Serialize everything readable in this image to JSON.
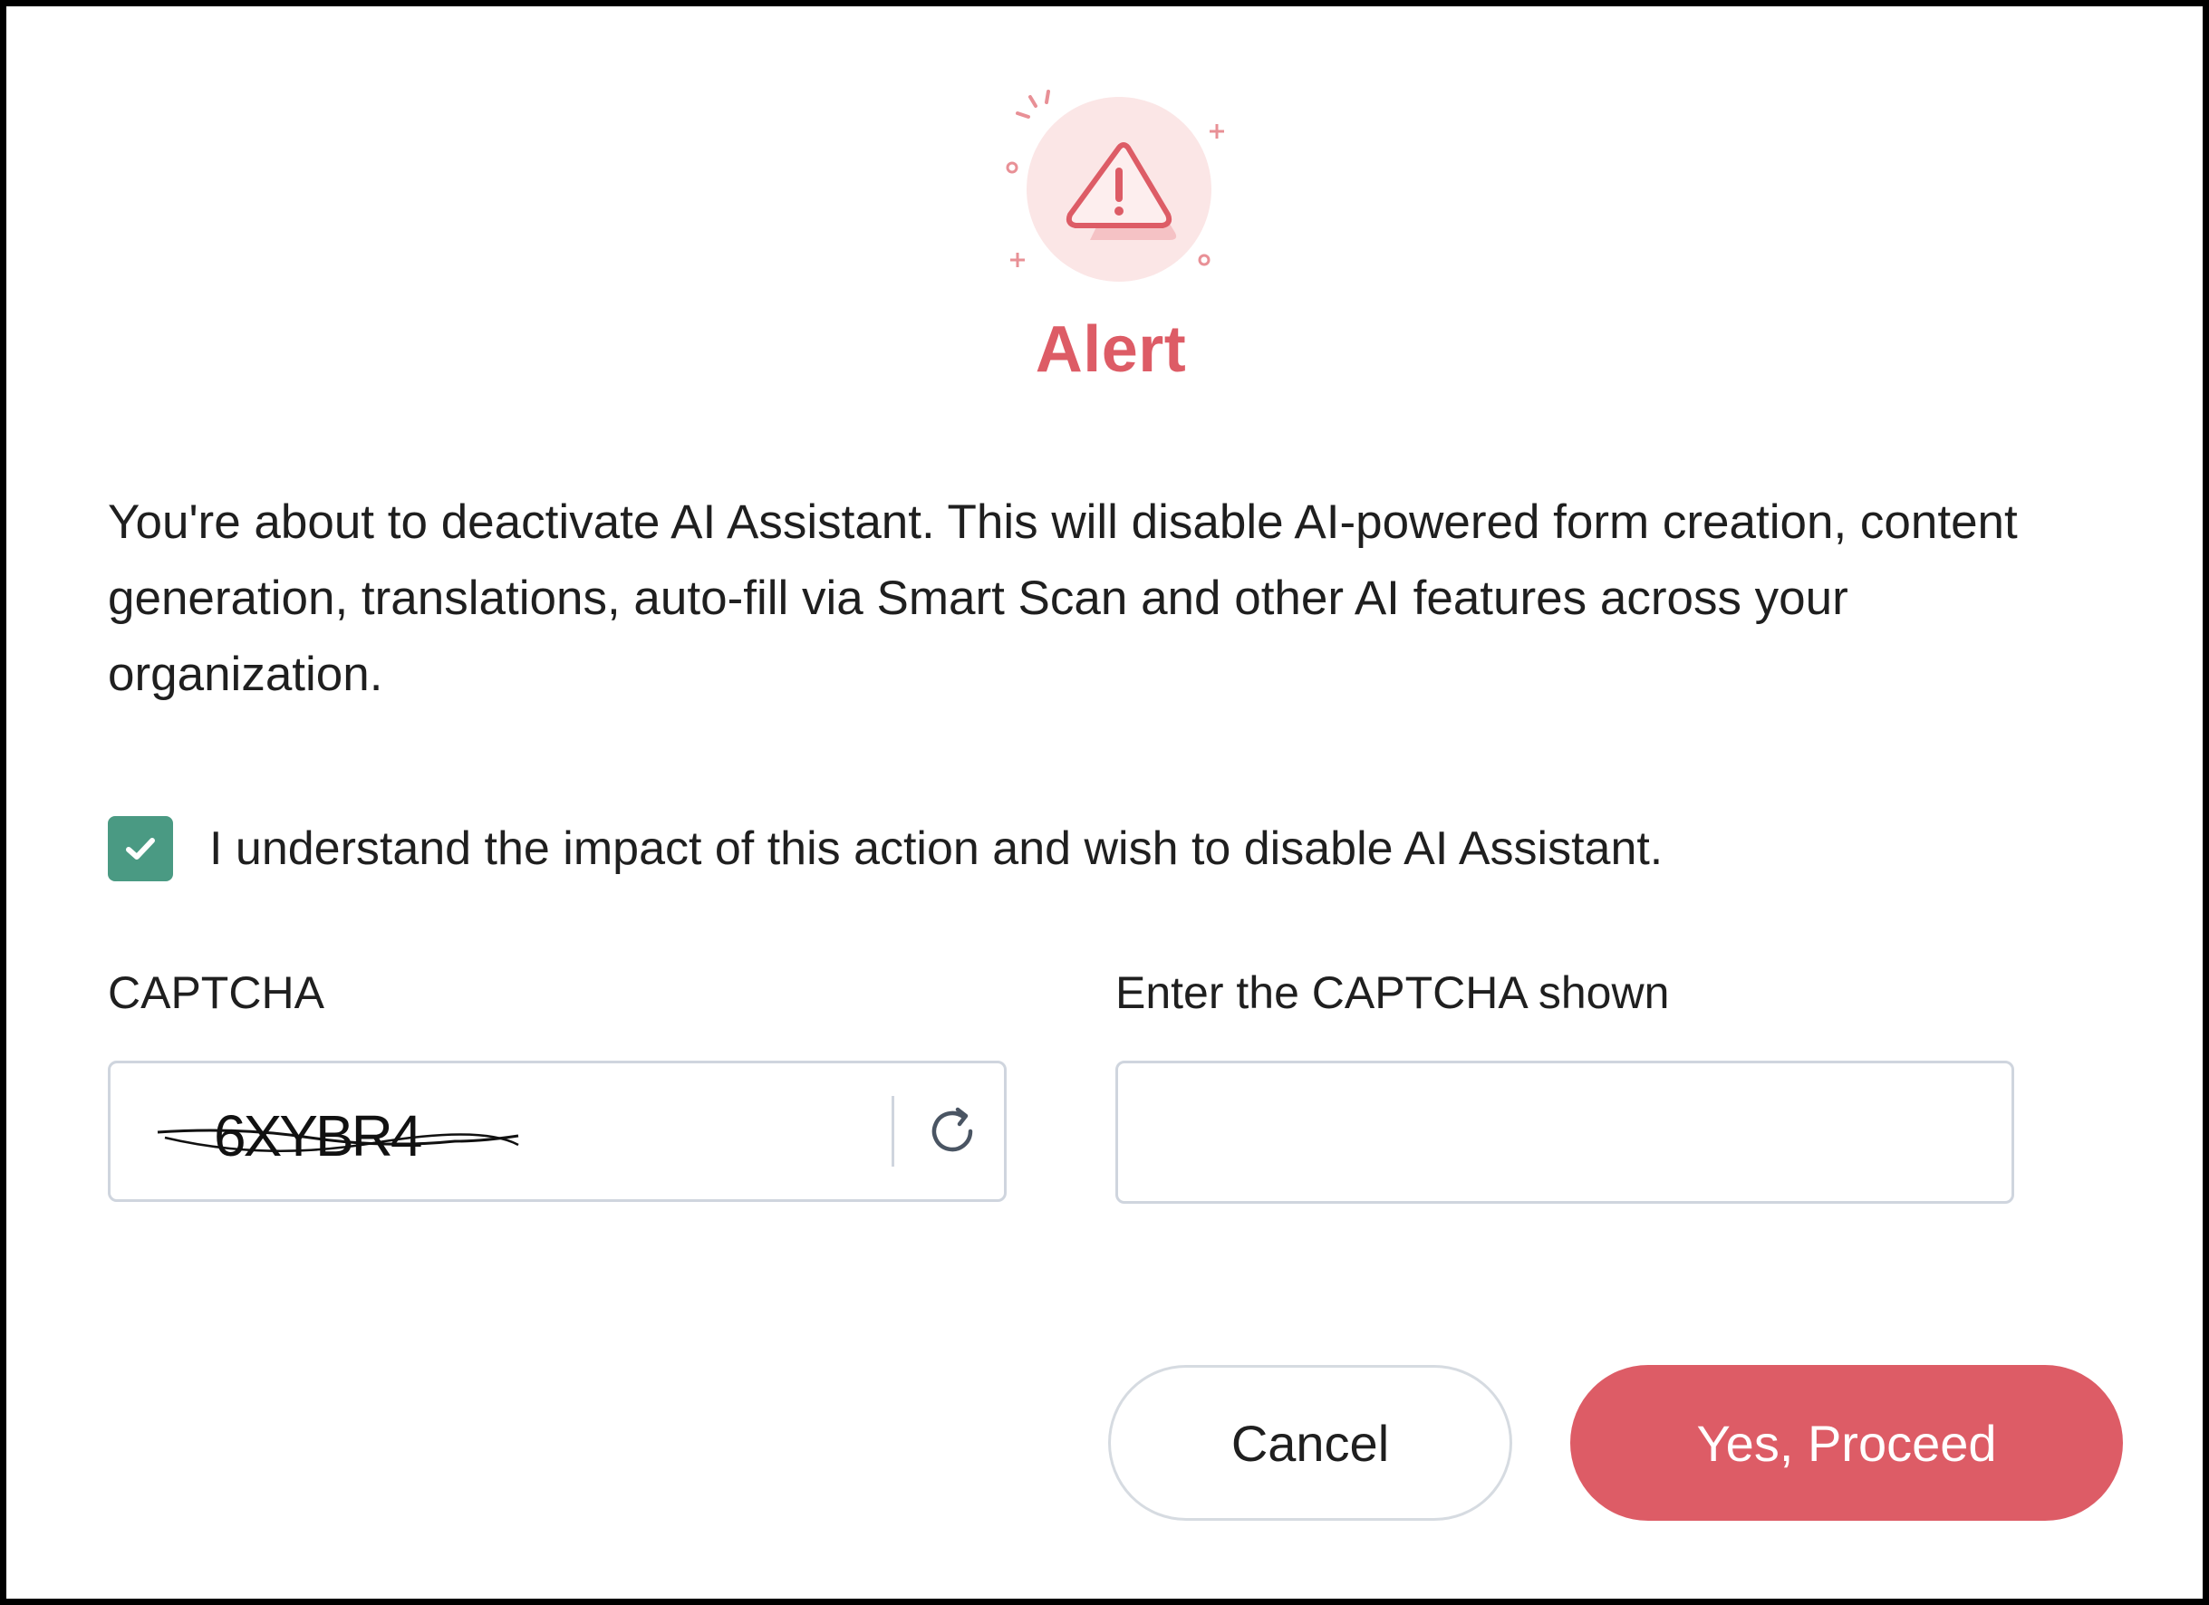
{
  "dialog": {
    "title": "Alert",
    "message": "You're about to deactivate AI Assistant. This will disable AI-powered form creation, content generation, translations, auto-fill via Smart Scan and other AI features across your organization.",
    "consent": {
      "label": "I understand the impact of this action and wish to disable AI Assistant.",
      "checked": true
    },
    "captcha": {
      "label": "CAPTCHA",
      "code": "6XYBR4",
      "refresh_icon": "refresh-icon"
    },
    "captcha_input": {
      "label": "Enter the CAPTCHA shown",
      "value": "",
      "placeholder": ""
    },
    "buttons": {
      "cancel": "Cancel",
      "proceed": "Yes, Proceed"
    }
  },
  "icons": {
    "alert": "warning-triangle-icon",
    "checkbox": "checkmark-icon"
  },
  "colors": {
    "accent": "#dd5c66",
    "accent_light": "#fbe6e6",
    "checkbox": "#4a9a83",
    "border": "#cfd5de",
    "text": "#1f1f1f"
  }
}
